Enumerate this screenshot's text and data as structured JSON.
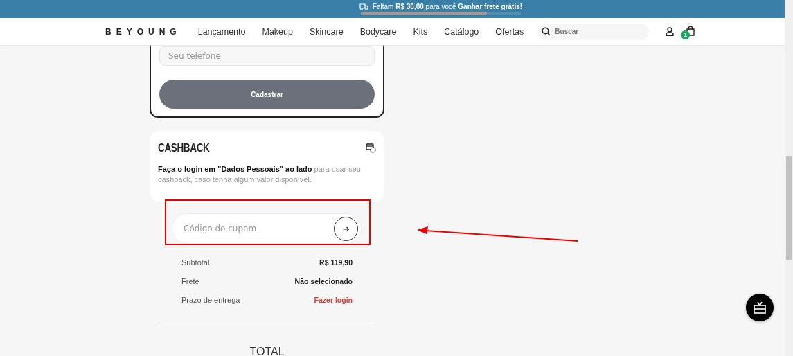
{
  "banner": {
    "prefix": "Faltam ",
    "amount": "R$ 30,00",
    "middle": " para você ",
    "goal": "Ganhar frete grátis!",
    "level": 0.79
  },
  "nav": {
    "logo": "BEYOUNG",
    "items": [
      "Lançamento",
      "Makeup",
      "Skincare",
      "Bodycare",
      "Kits",
      "Catálogo",
      "Ofertas"
    ],
    "search": {
      "placeholder": "Buscar"
    },
    "cart_count": "1"
  },
  "signup": {
    "phone": {
      "placeholder": "Seu telefone"
    },
    "button": "Cadastrar"
  },
  "cashback": {
    "title": "CASHBACK",
    "text": "**Faça o login em \"Dados Pessoais\" ao lado** para usar seu cashback, caso tenha algum valor disponível."
  },
  "coupon": {
    "placeholder": "Código do cupom"
  },
  "summary": [
    {
      "label": "Subtotal",
      "value": "R$ 119,90",
      "kind": "plain"
    },
    {
      "label": "Frete",
      "value": "Não selecionado",
      "kind": "plain"
    },
    {
      "label": "Prazo de entrega",
      "value": "Fazer login",
      "kind": "link"
    }
  ],
  "total": {
    "label": "TOTAL"
  }
}
